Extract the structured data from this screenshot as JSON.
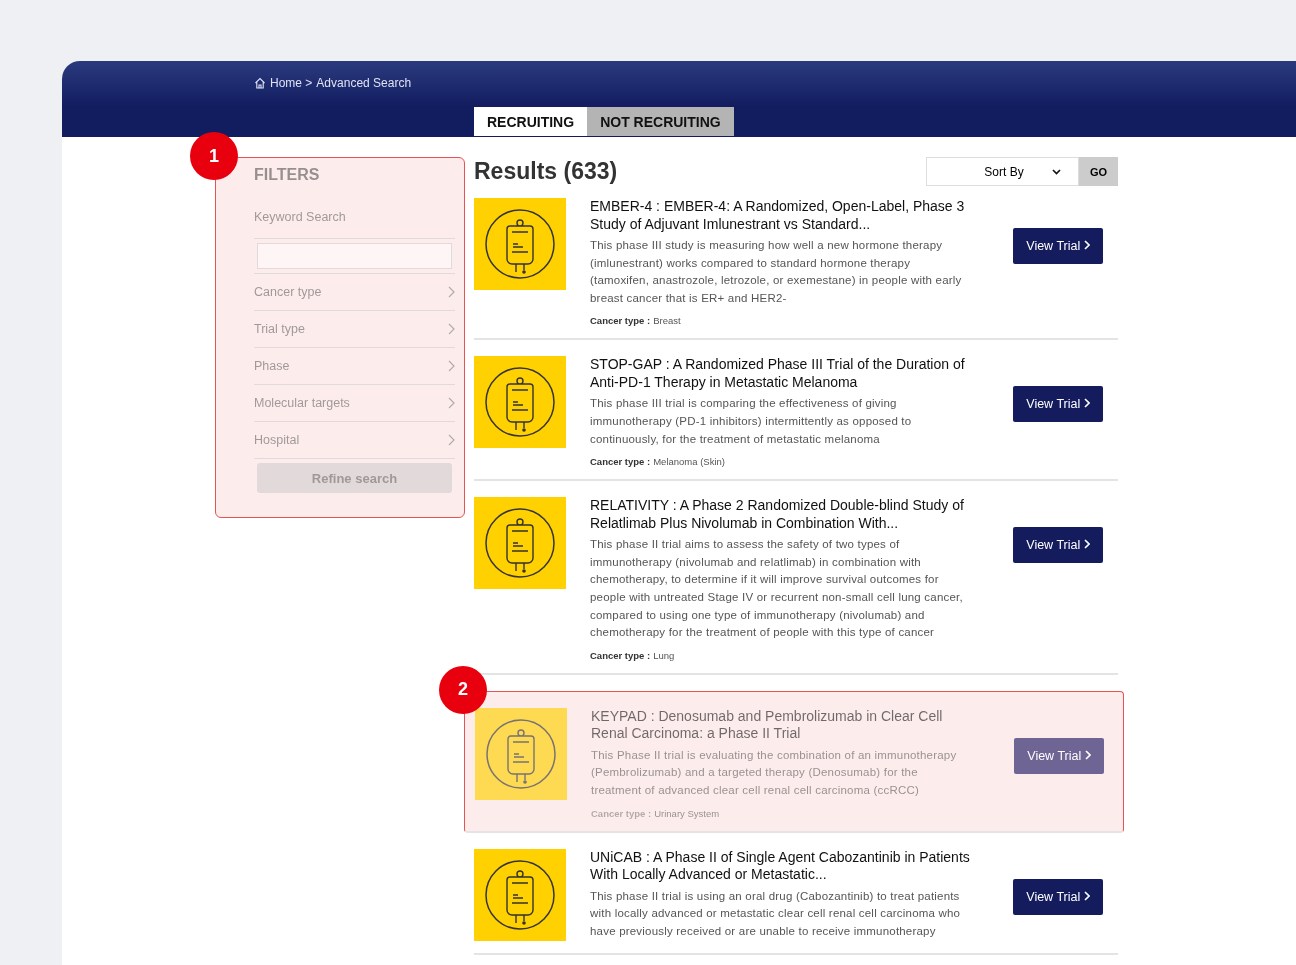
{
  "breadcrumb": [
    {
      "label": "Home >"
    },
    {
      "label": "Advanced Search"
    }
  ],
  "tabs": [
    {
      "label": "RECRUITING",
      "selected": true
    },
    {
      "label": "NOT RECRUITING",
      "selected": false
    }
  ],
  "filters": {
    "title": "FILTERS",
    "highlighted": true,
    "callout": "1",
    "keyword_label": "Keyword Search",
    "items": [
      {
        "label": "Cancer type"
      },
      {
        "label": "Trial type"
      },
      {
        "label": "Phase"
      },
      {
        "label": "Molecular targets"
      },
      {
        "label": "Hospital"
      }
    ],
    "refine_button": "Refine search"
  },
  "results": {
    "title": "Results (633)",
    "sort": "Sort By",
    "go_button": "GO"
  },
  "trials": [
    {
      "title": "EMBER-4 : EMBER-4: A Randomized, Open-Label, Phase 3 Study of Adjuvant Imlunestrant vs Standard...",
      "description": "This phase III study is measuring how well a new hormone therapy (imlunestrant) works compared to standard hormone therapy (tamoxifen, anastrozole, letrozole, or exemestane) in people with early breast cancer that is ER+ and HER2-",
      "cancer_label": "Cancer type :",
      "cancer_type": "Breast",
      "button": "View Trial",
      "highlighted": false
    },
    {
      "title": "STOP-GAP : A Randomized Phase III Trial of the Duration of Anti-PD-1 Therapy in Metastatic Melanoma",
      "description": "This phase III trial is comparing the effectiveness of giving immunotherapy (PD-1 inhibitors) intermittently as opposed to continuously, for the treatment of metastatic melanoma",
      "cancer_label": "Cancer type :",
      "cancer_type": "Melanoma (Skin)",
      "button": "View Trial",
      "highlighted": false
    },
    {
      "title": "RELATIVITY : A Phase 2 Randomized Double-blind Study of Relatlimab Plus Nivolumab in Combination With...",
      "description": "This phase II trial aims to assess the safety of two types of immunotherapy (nivolumab and relatlimab) in combination with chemotherapy, to determine if it will improve survival outcomes for people with untreated Stage IV or recurrent non-small cell lung cancer, compared to using one type of immunotherapy (nivolumab) and chemotherapy for the treatment of people with this type of cancer",
      "cancer_label": "Cancer type :",
      "cancer_type": "Lung",
      "button": "View Trial",
      "highlighted": false
    },
    {
      "title": "KEYPAD : Denosumab and Pembrolizumab in Clear Cell Renal Carcinoma: a Phase II Trial",
      "description": "This Phase II trial is evaluating the combination of an immunotherapy (Pembrolizumab) and a targeted therapy (Denosumab) for the treatment of advanced clear cell renal cell carcinoma (ccRCC)",
      "cancer_label": "Cancer type :",
      "cancer_type": "Urinary System",
      "button": "View Trial",
      "highlighted": true,
      "callout": "2"
    },
    {
      "title": "UNiCAB : A Phase II of Single Agent Cabozantinib in Patients With Locally Advanced or Metastatic...",
      "description": "This phase II trial is using an oral drug (Cabozantinib) to treat patients with locally advanced or metastatic clear cell renal cell carcinoma who have previously received or are unable to receive immunotherapy",
      "button": "View Trial",
      "highlighted": false
    }
  ]
}
